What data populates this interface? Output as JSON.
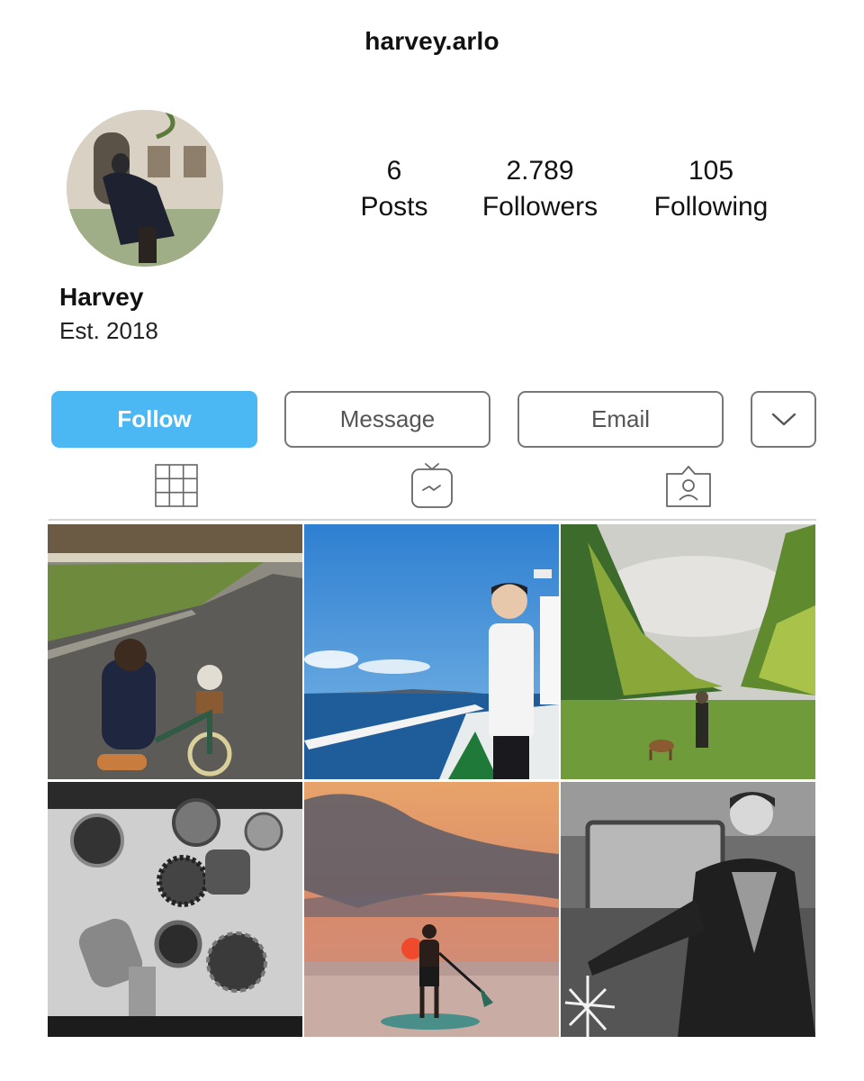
{
  "header": {
    "username": "harvey.arlo"
  },
  "profile": {
    "display_name": "Harvey",
    "bio": "Est. 2018",
    "avatar_icon": "profile-photo"
  },
  "stats": [
    {
      "value": "6",
      "label": "Posts"
    },
    {
      "value": "2.789",
      "label": "Followers"
    },
    {
      "value": "105",
      "label": "Following"
    }
  ],
  "actions": {
    "follow_label": "Follow",
    "message_label": "Message",
    "email_label": "Email",
    "more_icon": "chevron-down-icon",
    "accent_color": "#4bb8f4"
  },
  "tabs": [
    {
      "icon": "grid-icon"
    },
    {
      "icon": "igtv-icon"
    },
    {
      "icon": "tagged-person-icon"
    }
  ],
  "posts": [
    {
      "subject": "child on bicycle in park"
    },
    {
      "subject": "man on boat by the sea"
    },
    {
      "subject": "person walking dog in field"
    },
    {
      "subject": "disassembled engine parts"
    },
    {
      "subject": "paddleboarder at sunset"
    },
    {
      "subject": "man in suit by car"
    }
  ]
}
